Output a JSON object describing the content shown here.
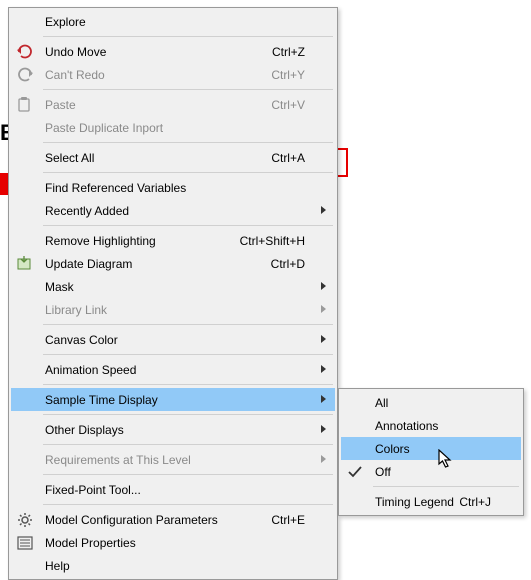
{
  "bg_letter": "B",
  "main_menu": {
    "items": [
      {
        "label": "Explore",
        "shortcut": "",
        "icon": null,
        "disabled": false,
        "submenu": false
      },
      {
        "sep": true
      },
      {
        "label": "Undo Move",
        "shortcut": "Ctrl+Z",
        "icon": "undo",
        "disabled": false,
        "submenu": false
      },
      {
        "label": "Can't Redo",
        "shortcut": "Ctrl+Y",
        "icon": "redo-gray",
        "disabled": true,
        "submenu": false
      },
      {
        "sep": true
      },
      {
        "label": "Paste",
        "shortcut": "Ctrl+V",
        "icon": "paste-gray",
        "disabled": true,
        "submenu": false
      },
      {
        "label": "Paste Duplicate Inport",
        "shortcut": "",
        "icon": null,
        "disabled": true,
        "submenu": false
      },
      {
        "sep": true
      },
      {
        "label": "Select All",
        "shortcut": "Ctrl+A",
        "icon": null,
        "disabled": false,
        "submenu": false
      },
      {
        "sep": true
      },
      {
        "label": "Find Referenced Variables",
        "shortcut": "",
        "icon": null,
        "disabled": false,
        "submenu": false
      },
      {
        "label": "Recently Added",
        "shortcut": "",
        "icon": null,
        "disabled": false,
        "submenu": true
      },
      {
        "sep": true
      },
      {
        "label": "Remove Highlighting",
        "shortcut": "Ctrl+Shift+H",
        "icon": null,
        "disabled": false,
        "submenu": false
      },
      {
        "label": "Update Diagram",
        "shortcut": "Ctrl+D",
        "icon": "update",
        "disabled": false,
        "submenu": false
      },
      {
        "label": "Mask",
        "shortcut": "",
        "icon": null,
        "disabled": false,
        "submenu": true
      },
      {
        "label": "Library Link",
        "shortcut": "",
        "icon": null,
        "disabled": true,
        "submenu": true
      },
      {
        "sep": true
      },
      {
        "label": "Canvas Color",
        "shortcut": "",
        "icon": null,
        "disabled": false,
        "submenu": true
      },
      {
        "sep": true
      },
      {
        "label": "Animation Speed",
        "shortcut": "",
        "icon": null,
        "disabled": false,
        "submenu": true
      },
      {
        "sep": true
      },
      {
        "label": "Sample Time Display",
        "shortcut": "",
        "icon": null,
        "disabled": false,
        "submenu": true,
        "highlight": true
      },
      {
        "sep": true
      },
      {
        "label": "Other Displays",
        "shortcut": "",
        "icon": null,
        "disabled": false,
        "submenu": true
      },
      {
        "sep": true
      },
      {
        "label": "Requirements at This Level",
        "shortcut": "",
        "icon": null,
        "disabled": true,
        "submenu": true
      },
      {
        "sep": true
      },
      {
        "label": "Fixed-Point Tool...",
        "shortcut": "",
        "icon": null,
        "disabled": false,
        "submenu": false
      },
      {
        "sep": true
      },
      {
        "label": "Model Configuration Parameters",
        "shortcut": "Ctrl+E",
        "icon": "gear",
        "disabled": false,
        "submenu": false
      },
      {
        "label": "Model Properties",
        "shortcut": "",
        "icon": "properties",
        "disabled": false,
        "submenu": false
      },
      {
        "label": "Help",
        "shortcut": "",
        "icon": null,
        "disabled": false,
        "submenu": false
      }
    ]
  },
  "sub_menu": {
    "items": [
      {
        "label": "All",
        "shortcut": "",
        "icon": null,
        "disabled": false
      },
      {
        "label": "Annotations",
        "shortcut": "",
        "icon": null,
        "disabled": false
      },
      {
        "label": "Colors",
        "shortcut": "",
        "icon": null,
        "disabled": false,
        "highlight": true
      },
      {
        "label": "Off",
        "shortcut": "",
        "icon": "check",
        "disabled": false
      },
      {
        "sep": true
      },
      {
        "label": "Timing Legend",
        "shortcut": "Ctrl+J",
        "icon": null,
        "disabled": false
      }
    ]
  }
}
